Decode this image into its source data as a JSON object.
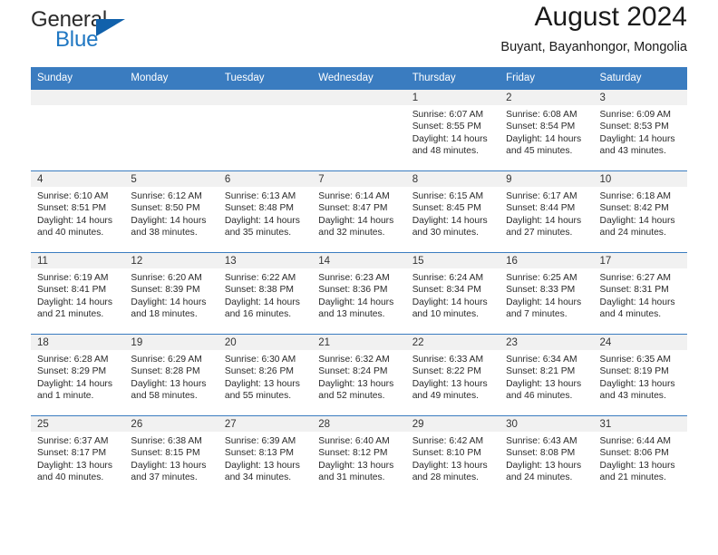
{
  "brand": {
    "word1": "General",
    "word2": "Blue",
    "triangle_color": "#1161ab",
    "blue_color": "#1f77c2"
  },
  "header": {
    "title": "August 2024",
    "subtitle": "Buyant, Bayanhongor, Mongolia",
    "accent_color": "#3a7cc0"
  },
  "weekday_headers": [
    "Sunday",
    "Monday",
    "Tuesday",
    "Wednesday",
    "Thursday",
    "Friday",
    "Saturday"
  ],
  "labels": {
    "sunrise": "Sunrise:",
    "sunset": "Sunset:",
    "daylight": "Daylight:"
  },
  "weeks": [
    [
      {
        "day": "",
        "empty": true
      },
      {
        "day": "",
        "empty": true
      },
      {
        "day": "",
        "empty": true
      },
      {
        "day": "",
        "empty": true
      },
      {
        "day": "1",
        "sunrise": "Sunrise: 6:07 AM",
        "sunset": "Sunset: 8:55 PM",
        "daylight1": "Daylight: 14 hours",
        "daylight2": "and 48 minutes."
      },
      {
        "day": "2",
        "sunrise": "Sunrise: 6:08 AM",
        "sunset": "Sunset: 8:54 PM",
        "daylight1": "Daylight: 14 hours",
        "daylight2": "and 45 minutes."
      },
      {
        "day": "3",
        "sunrise": "Sunrise: 6:09 AM",
        "sunset": "Sunset: 8:53 PM",
        "daylight1": "Daylight: 14 hours",
        "daylight2": "and 43 minutes."
      }
    ],
    [
      {
        "day": "4",
        "sunrise": "Sunrise: 6:10 AM",
        "sunset": "Sunset: 8:51 PM",
        "daylight1": "Daylight: 14 hours",
        "daylight2": "and 40 minutes."
      },
      {
        "day": "5",
        "sunrise": "Sunrise: 6:12 AM",
        "sunset": "Sunset: 8:50 PM",
        "daylight1": "Daylight: 14 hours",
        "daylight2": "and 38 minutes."
      },
      {
        "day": "6",
        "sunrise": "Sunrise: 6:13 AM",
        "sunset": "Sunset: 8:48 PM",
        "daylight1": "Daylight: 14 hours",
        "daylight2": "and 35 minutes."
      },
      {
        "day": "7",
        "sunrise": "Sunrise: 6:14 AM",
        "sunset": "Sunset: 8:47 PM",
        "daylight1": "Daylight: 14 hours",
        "daylight2": "and 32 minutes."
      },
      {
        "day": "8",
        "sunrise": "Sunrise: 6:15 AM",
        "sunset": "Sunset: 8:45 PM",
        "daylight1": "Daylight: 14 hours",
        "daylight2": "and 30 minutes."
      },
      {
        "day": "9",
        "sunrise": "Sunrise: 6:17 AM",
        "sunset": "Sunset: 8:44 PM",
        "daylight1": "Daylight: 14 hours",
        "daylight2": "and 27 minutes."
      },
      {
        "day": "10",
        "sunrise": "Sunrise: 6:18 AM",
        "sunset": "Sunset: 8:42 PM",
        "daylight1": "Daylight: 14 hours",
        "daylight2": "and 24 minutes."
      }
    ],
    [
      {
        "day": "11",
        "sunrise": "Sunrise: 6:19 AM",
        "sunset": "Sunset: 8:41 PM",
        "daylight1": "Daylight: 14 hours",
        "daylight2": "and 21 minutes."
      },
      {
        "day": "12",
        "sunrise": "Sunrise: 6:20 AM",
        "sunset": "Sunset: 8:39 PM",
        "daylight1": "Daylight: 14 hours",
        "daylight2": "and 18 minutes."
      },
      {
        "day": "13",
        "sunrise": "Sunrise: 6:22 AM",
        "sunset": "Sunset: 8:38 PM",
        "daylight1": "Daylight: 14 hours",
        "daylight2": "and 16 minutes."
      },
      {
        "day": "14",
        "sunrise": "Sunrise: 6:23 AM",
        "sunset": "Sunset: 8:36 PM",
        "daylight1": "Daylight: 14 hours",
        "daylight2": "and 13 minutes."
      },
      {
        "day": "15",
        "sunrise": "Sunrise: 6:24 AM",
        "sunset": "Sunset: 8:34 PM",
        "daylight1": "Daylight: 14 hours",
        "daylight2": "and 10 minutes."
      },
      {
        "day": "16",
        "sunrise": "Sunrise: 6:25 AM",
        "sunset": "Sunset: 8:33 PM",
        "daylight1": "Daylight: 14 hours",
        "daylight2": "and 7 minutes."
      },
      {
        "day": "17",
        "sunrise": "Sunrise: 6:27 AM",
        "sunset": "Sunset: 8:31 PM",
        "daylight1": "Daylight: 14 hours",
        "daylight2": "and 4 minutes."
      }
    ],
    [
      {
        "day": "18",
        "sunrise": "Sunrise: 6:28 AM",
        "sunset": "Sunset: 8:29 PM",
        "daylight1": "Daylight: 14 hours",
        "daylight2": "and 1 minute."
      },
      {
        "day": "19",
        "sunrise": "Sunrise: 6:29 AM",
        "sunset": "Sunset: 8:28 PM",
        "daylight1": "Daylight: 13 hours",
        "daylight2": "and 58 minutes."
      },
      {
        "day": "20",
        "sunrise": "Sunrise: 6:30 AM",
        "sunset": "Sunset: 8:26 PM",
        "daylight1": "Daylight: 13 hours",
        "daylight2": "and 55 minutes."
      },
      {
        "day": "21",
        "sunrise": "Sunrise: 6:32 AM",
        "sunset": "Sunset: 8:24 PM",
        "daylight1": "Daylight: 13 hours",
        "daylight2": "and 52 minutes."
      },
      {
        "day": "22",
        "sunrise": "Sunrise: 6:33 AM",
        "sunset": "Sunset: 8:22 PM",
        "daylight1": "Daylight: 13 hours",
        "daylight2": "and 49 minutes."
      },
      {
        "day": "23",
        "sunrise": "Sunrise: 6:34 AM",
        "sunset": "Sunset: 8:21 PM",
        "daylight1": "Daylight: 13 hours",
        "daylight2": "and 46 minutes."
      },
      {
        "day": "24",
        "sunrise": "Sunrise: 6:35 AM",
        "sunset": "Sunset: 8:19 PM",
        "daylight1": "Daylight: 13 hours",
        "daylight2": "and 43 minutes."
      }
    ],
    [
      {
        "day": "25",
        "sunrise": "Sunrise: 6:37 AM",
        "sunset": "Sunset: 8:17 PM",
        "daylight1": "Daylight: 13 hours",
        "daylight2": "and 40 minutes."
      },
      {
        "day": "26",
        "sunrise": "Sunrise: 6:38 AM",
        "sunset": "Sunset: 8:15 PM",
        "daylight1": "Daylight: 13 hours",
        "daylight2": "and 37 minutes."
      },
      {
        "day": "27",
        "sunrise": "Sunrise: 6:39 AM",
        "sunset": "Sunset: 8:13 PM",
        "daylight1": "Daylight: 13 hours",
        "daylight2": "and 34 minutes."
      },
      {
        "day": "28",
        "sunrise": "Sunrise: 6:40 AM",
        "sunset": "Sunset: 8:12 PM",
        "daylight1": "Daylight: 13 hours",
        "daylight2": "and 31 minutes."
      },
      {
        "day": "29",
        "sunrise": "Sunrise: 6:42 AM",
        "sunset": "Sunset: 8:10 PM",
        "daylight1": "Daylight: 13 hours",
        "daylight2": "and 28 minutes."
      },
      {
        "day": "30",
        "sunrise": "Sunrise: 6:43 AM",
        "sunset": "Sunset: 8:08 PM",
        "daylight1": "Daylight: 13 hours",
        "daylight2": "and 24 minutes."
      },
      {
        "day": "31",
        "sunrise": "Sunrise: 6:44 AM",
        "sunset": "Sunset: 8:06 PM",
        "daylight1": "Daylight: 13 hours",
        "daylight2": "and 21 minutes."
      }
    ]
  ]
}
